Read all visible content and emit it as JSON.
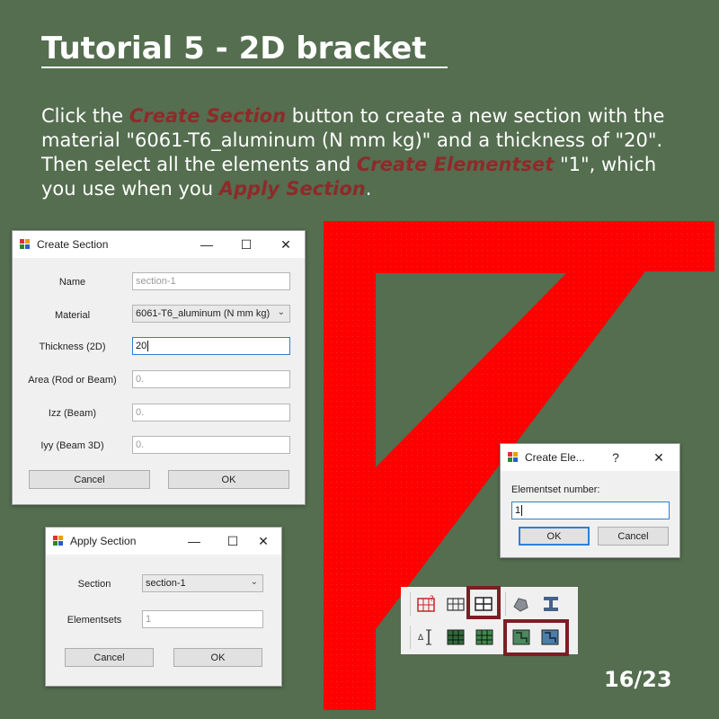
{
  "slide": {
    "title": "Tutorial 5 - 2D bracket  ",
    "instruction": {
      "p1": "Click the ",
      "h1": "Create Section",
      "p2": " button to create a new section with the material \"6061-T6_aluminum (N mm kg)\" and a thickness of \"20\". Then select all the elements and ",
      "h2": "Create Elementset",
      "p3": " \"1\", which you use when you ",
      "h3": "Apply Section",
      "p4": "."
    },
    "page_number": "16/23"
  },
  "colors": {
    "background": "#546e4f",
    "highlight": "#8e2a2a",
    "bracket": "#ff0000",
    "box": "#7a1f24"
  },
  "create_section": {
    "title": "Create Section",
    "fields": {
      "name_label": "Name",
      "name_placeholder": "section-1",
      "material_label": "Material",
      "material_value": "6061-T6_aluminum (N mm kg)",
      "thickness_label": "Thickness (2D)",
      "thickness_value": "20",
      "area_label": "Area (Rod or Beam)",
      "area_placeholder": "0.",
      "izz_label": "Izz (Beam)",
      "izz_placeholder": "0.",
      "iyy_label": "Iyy (Beam 3D)",
      "iyy_placeholder": "0."
    },
    "cancel_label": "Cancel",
    "ok_label": "OK"
  },
  "apply_section": {
    "title": "Apply Section",
    "section_label": "Section",
    "section_value": "section-1",
    "elementsets_label": "Elementsets",
    "elementsets_placeholder": "1",
    "cancel_label": "Cancel",
    "ok_label": "OK"
  },
  "create_elementset": {
    "title": "Create Ele...",
    "help": "?",
    "close": "✕",
    "number_label": "Elementset number:",
    "number_value": "1",
    "ok_label": "OK",
    "cancel_label": "Cancel"
  },
  "window_controls": {
    "minimize": "—",
    "maximize": "☐",
    "close": "✕"
  },
  "toolbar": {
    "icons": [
      "create-mesh-icon",
      "mesh-grid-icon",
      "create-elementset-icon",
      "material-icon",
      "section-icon",
      "dimension-icon",
      "mesh-dark-icon",
      "mesh-fill-icon",
      "create-section-icon",
      "apply-section-icon"
    ]
  }
}
